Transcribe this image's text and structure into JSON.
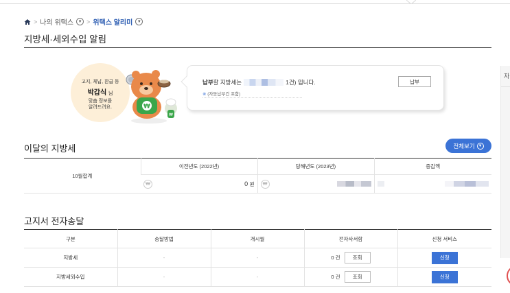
{
  "breadcrumb": {
    "items": [
      "나의 위택스",
      "위택스 알리미"
    ]
  },
  "page_title": "지방세·세외수입 알림",
  "mascot": {
    "line1": "고지, 체납, 환급 등",
    "name": "박갑식",
    "honorific": "님",
    "line3a": "맞춤 정보를",
    "line3b": "알려드려요."
  },
  "notice": {
    "bold": "납부",
    "text_pre": "할 지방세는",
    "text_post": "1건) 입니다.",
    "sub_mark": "※",
    "sub": "(자동납부건 포함)",
    "pay_button": "납부"
  },
  "monthly": {
    "title": "이달의 지방세",
    "view_all": "전체보기",
    "row_label": "10월합계",
    "headers": [
      "이전년도 (2022년)",
      "당해년도 (2023년)",
      "증감액"
    ],
    "won_symbol": "₩",
    "prev_amount": "0",
    "unit": "원"
  },
  "delivery": {
    "title": "고지서 전자송달",
    "headers": [
      "구분",
      "송달방법",
      "개시월",
      "전자사서함",
      "신청 서비스"
    ],
    "rows": [
      {
        "type": "지방세",
        "method": "-",
        "start": "-",
        "count": "0 건",
        "view": "조회",
        "apply": "신청"
      },
      {
        "type": "지방세외수입",
        "method": "-",
        "start": "-",
        "count": "0 건",
        "view": "조회",
        "apply": "신청"
      }
    ]
  },
  "side": {
    "label": "자"
  },
  "colors": {
    "accent": "#3b73d6",
    "mascot_bg": "#fdefd8",
    "mascot_body": "#e9894a",
    "apron": "#3aa64a"
  }
}
